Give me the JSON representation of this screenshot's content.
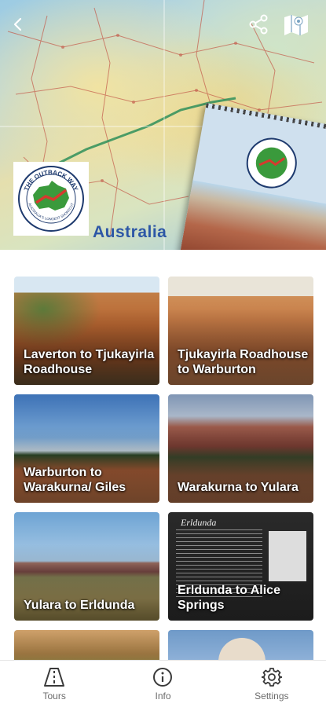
{
  "header": {
    "map_title": "Australia",
    "logo_text_top": "THE OUTBACK WAY",
    "logo_text_bottom": "AUSTRALIA'S LONGEST SHORTCUT",
    "icons": [
      "chevron-left-icon",
      "share-icon",
      "map-icon"
    ]
  },
  "tours": [
    {
      "label": "Laverton to Tjukayirla Roadhouse"
    },
    {
      "label": "Tjukayirla Roadhouse to Warburton"
    },
    {
      "label": "Warburton to Warakurna/ Giles"
    },
    {
      "label": "Warakurna to Yulara"
    },
    {
      "label": "Yulara to Erldunda"
    },
    {
      "label": "Erldunda to Alice Springs",
      "sign_title": "Erldunda"
    },
    {
      "label": ""
    },
    {
      "label": ""
    }
  ],
  "nav": {
    "items": [
      {
        "label": "Tours",
        "icon": "road-icon"
      },
      {
        "label": "Info",
        "icon": "info-icon"
      },
      {
        "label": "Settings",
        "icon": "gear-icon"
      }
    ]
  },
  "colors": {
    "map_title": "#2d57a6",
    "nav_label": "#6b6b6b",
    "logo_red": "#d63a2e",
    "logo_green": "#3a9a3c"
  }
}
